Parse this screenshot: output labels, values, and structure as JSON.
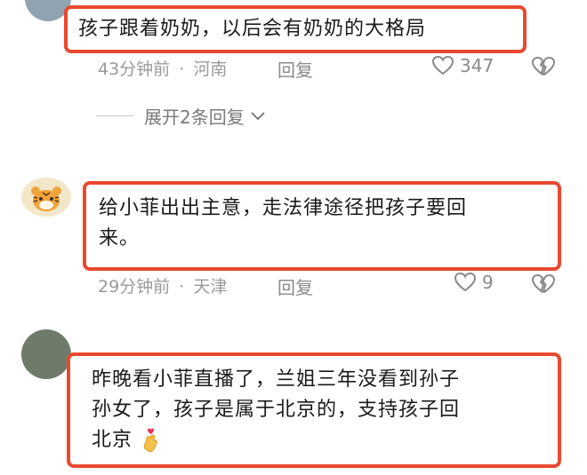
{
  "comments": [
    {
      "text": "孩子跟着奶奶，以后会有奶奶的大格局",
      "time": "43分钟前",
      "separator": "·",
      "location": "河南",
      "reply_label": "回复",
      "likes": "347"
    },
    {
      "text_line1": "给小菲出出主意，走法律途径把孩子要回",
      "text_line2": "来。",
      "time": "29分钟前",
      "separator": "·",
      "location": "天津",
      "reply_label": "回复",
      "likes": "9"
    },
    {
      "text_line1": "昨晚看小菲直播了，兰姐三年没看到孙子",
      "text_line2": "孙女了，孩子是属于北京的，支持孩子回",
      "text_line3": "北京"
    }
  ],
  "expand_replies": {
    "label": "展开2条回复"
  },
  "colors": {
    "highlight_border": "#e8492f",
    "meta_text": "#9a9a9a"
  },
  "icons": [
    "heart-icon",
    "broken-heart-icon",
    "chevron-down-icon",
    "finger-heart-emoji"
  ]
}
